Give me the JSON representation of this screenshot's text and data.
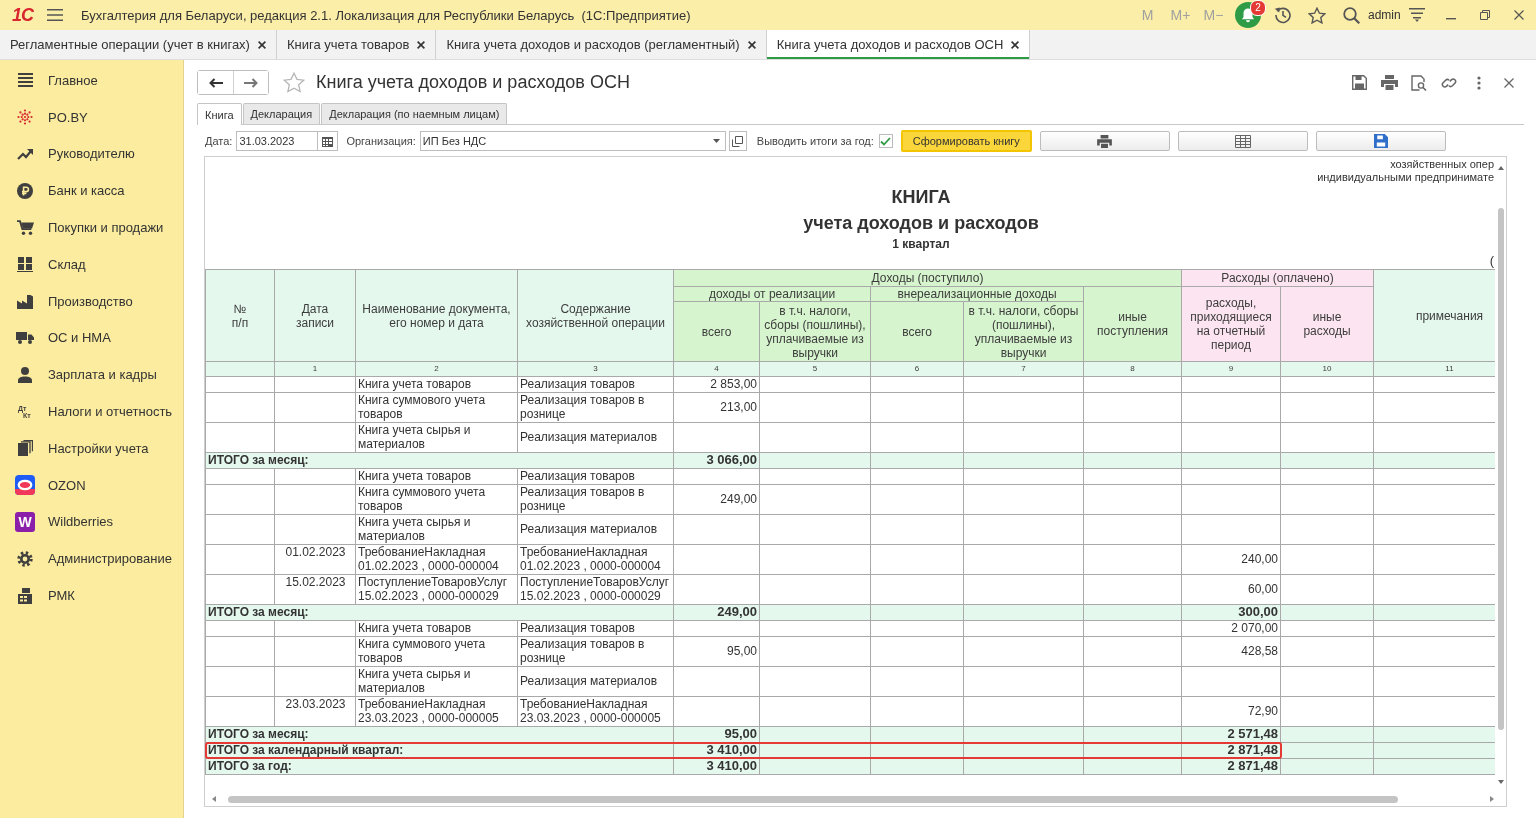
{
  "app_bar": {
    "logo": "1С",
    "title": "Бухгалтерия для Беларуси, редакция 2.1. Локализация для Республики Беларусь  (1С:Предприятие)",
    "memory_buttons": [
      "M",
      "M+",
      "M−"
    ],
    "notification_count": "2",
    "user": "admin"
  },
  "open_tabs": [
    {
      "label": "Регламентные операции (учет в книгах)",
      "selected": false
    },
    {
      "label": "Книга учета товаров",
      "selected": false
    },
    {
      "label": "Книга учета доходов и расходов (регламентный)",
      "selected": false
    },
    {
      "label": "Книга учета доходов и расходов ОСН",
      "selected": true
    }
  ],
  "sidebar": {
    "items": [
      {
        "label": "Главное"
      },
      {
        "label": "PO.BY"
      },
      {
        "label": "Руководителю"
      },
      {
        "label": "Банк и касса"
      },
      {
        "label": "Покупки и продажи"
      },
      {
        "label": "Склад"
      },
      {
        "label": "Производство"
      },
      {
        "label": "ОС и НМА"
      },
      {
        "label": "Зарплата и кадры"
      },
      {
        "label": "Налоги и отчетность",
        "icon_text": [
          "Дт",
          "Кт"
        ]
      },
      {
        "label": "Настройки учета"
      },
      {
        "label": "OZON"
      },
      {
        "label": "Wildberries",
        "icon_text": [
          "W"
        ]
      },
      {
        "label": "Администрирование"
      },
      {
        "label": "РМК"
      }
    ]
  },
  "document": {
    "title": "Книга учета доходов и расходов ОСН",
    "favorite": false,
    "tabs": [
      {
        "label": "Книга",
        "selected": true
      },
      {
        "label": "Декларация",
        "selected": false
      },
      {
        "label": "Декларация (по наемным лицам)",
        "selected": false
      }
    ],
    "filters": {
      "date_label": "Дата:",
      "date": "31.03.2023",
      "organization_label": "Организация:",
      "organization": "ИП Без НДС",
      "year_totals_label": "Выводить итоги за год:",
      "year_totals_checked": true,
      "generate_button": "Сформировать книгу"
    },
    "report": {
      "header_lines": [
        "хозяйственных опер",
        "индивидуальными предпринимате"
      ],
      "title": "КНИГА",
      "subtitle": "учета доходов и расходов",
      "period": "1 квартал",
      "side_mark": "(",
      "columns": [
        {
          "label": "№\nп/п",
          "kind": "info"
        },
        {
          "label": "Дата\nзаписи",
          "kind": "info",
          "number": "1"
        },
        {
          "label": "Наименование документа,\nего номер и дата",
          "kind": "info",
          "number": "2"
        },
        {
          "label": "Содержание\nхозяйственной операции",
          "kind": "info",
          "number": "3"
        },
        {
          "label": "Доходы (поступило)",
          "kind": "income",
          "children": [
            {
              "label": "доходы от реализации",
              "children": [
                {
                  "label": "всего",
                  "number": "4"
                },
                {
                  "label": "в т.ч. налоги,\nсборы (пошлины),\nуплачиваемые из\nвыручки",
                  "number": "5"
                }
              ]
            },
            {
              "label": "внереализационные доходы",
              "children": [
                {
                  "label": "всего",
                  "number": "6"
                },
                {
                  "label": "в т.ч. налоги, сборы\n(пошлины),\nуплачиваемые из\nвыручки",
                  "number": "7"
                }
              ]
            },
            {
              "label": "иные\nпоступления",
              "number": "8"
            }
          ]
        },
        {
          "label": "Расходы (оплачено)",
          "kind": "expense",
          "children": [
            {
              "label": "расходы,\nприходящиеся\nна отчетный\nпериод",
              "number": "9"
            },
            {
              "label": "иные\nрасходы",
              "number": "10"
            }
          ]
        },
        {
          "label": "примечания",
          "kind": "info",
          "number": "11"
        }
      ],
      "rows": [
        {
          "kind": "entry",
          "document": "Книга учета товаров",
          "operation": "Реализация товаров",
          "income_total": "2 853,00",
          "highlighted": false
        },
        {
          "kind": "entry",
          "document": "Книга суммового учета товаров",
          "operation": "Реализация товаров в рознице",
          "income_total": "213,00",
          "highlighted": false
        },
        {
          "kind": "entry",
          "document": "Книга учета сырья и материалов",
          "operation": "Реализация материалов",
          "highlighted": false
        },
        {
          "kind": "total",
          "label": "ИТОГО за месяц:",
          "income_total": "3 066,00",
          "highlighted": false
        },
        {
          "kind": "entry",
          "document": "Книга учета товаров",
          "operation": "Реализация товаров",
          "highlighted": false
        },
        {
          "kind": "entry",
          "document": "Книга суммового учета товаров",
          "operation": "Реализация товаров в рознице",
          "income_total": "249,00",
          "highlighted": false
        },
        {
          "kind": "entry",
          "document": "Книга учета сырья и материалов",
          "operation": "Реализация материалов",
          "highlighted": false
        },
        {
          "kind": "entry",
          "date": "01.02.2023",
          "document": "ТребованиеНакладная 01.02.2023 , 0000-000004",
          "operation": "ТребованиеНакладная 01.02.2023 , 0000-000004",
          "expenses_period": "240,00",
          "highlighted": false
        },
        {
          "kind": "entry",
          "date": "15.02.2023",
          "document": "ПоступлениеТоваровУслуг 15.02.2023 , 0000-000029",
          "operation": "ПоступлениеТоваровУслуг 15.02.2023 , 0000-000029",
          "expenses_period": "60,00",
          "highlighted": false
        },
        {
          "kind": "total",
          "label": "ИТОГО за месяц:",
          "income_total": "249,00",
          "expenses_period": "300,00",
          "highlighted": false
        },
        {
          "kind": "entry",
          "document": "Книга учета товаров",
          "operation": "Реализация товаров",
          "expenses_period": "2 070,00",
          "highlighted": false
        },
        {
          "kind": "entry",
          "document": "Книга суммового учета товаров",
          "operation": "Реализация товаров в рознице",
          "income_total": "95,00",
          "expenses_period": "428,58",
          "highlighted": false
        },
        {
          "kind": "entry",
          "document": "Книга учета сырья и материалов",
          "operation": "Реализация материалов",
          "highlighted": false
        },
        {
          "kind": "entry",
          "date": "23.03.2023",
          "document": "ТребованиеНакладная 23.03.2023 , 0000-000005",
          "operation": "ТребованиеНакладная 23.03.2023 , 0000-000005",
          "expenses_period": "72,90",
          "highlighted": false
        },
        {
          "kind": "total",
          "label": "ИТОГО за месяц:",
          "income_total": "95,00",
          "expenses_period": "2 571,48",
          "highlighted": false
        },
        {
          "kind": "total",
          "label": "ИТОГО за календарный квартал:",
          "income_total": "3 410,00",
          "expenses_period": "2 871,48",
          "highlighted": true
        },
        {
          "kind": "total",
          "label": "ИТОГО за год:",
          "income_total": "3 410,00",
          "expenses_period": "2 871,48",
          "highlighted": false
        }
      ]
    }
  }
}
